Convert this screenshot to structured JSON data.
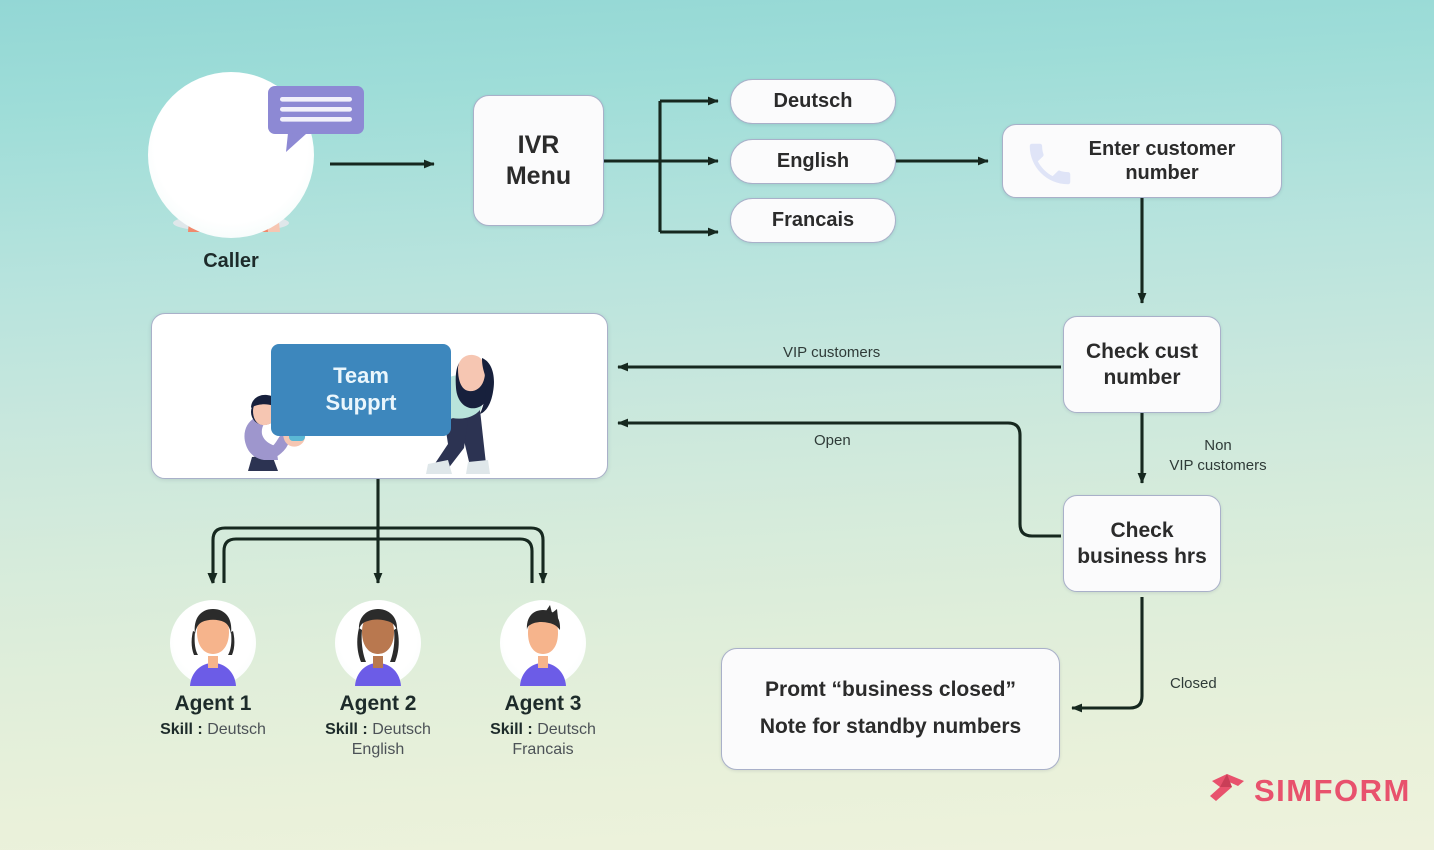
{
  "diagram": {
    "title": "IVR call routing flow",
    "caller": {
      "label": "Caller",
      "icon": "person-on-phone-illustration",
      "bubble": "chat-bubble-icon"
    },
    "ivr": {
      "line1": "IVR",
      "line2": "Menu"
    },
    "languages": [
      {
        "label": "Deutsch"
      },
      {
        "label": "English"
      },
      {
        "label": "Francais"
      }
    ],
    "enter_number": {
      "line1": "Enter customer",
      "line2": "number",
      "icon": "phone-handset-icon"
    },
    "check_cust": {
      "line1": "Check cust",
      "line2": "number"
    },
    "check_hours": {
      "line1": "Check",
      "line2": "business hrs"
    },
    "team": {
      "line1": "Team",
      "line2": "Supprt",
      "banner_color": "#3d87bd"
    },
    "prompt_box": {
      "line1": "Promt “business closed”",
      "line2": "Note for standby numbers"
    },
    "edge_labels": {
      "vip": "VIP customers",
      "open": "Open",
      "non_vip_line1": "Non",
      "non_vip_line2": "VIP customers",
      "closed": "Closed"
    },
    "agents": [
      {
        "name": "Agent 1",
        "skill_label": "Skill :",
        "skills": [
          "Deutsch"
        ]
      },
      {
        "name": "Agent 2",
        "skill_label": "Skill :",
        "skills": [
          "Deutsch",
          "English"
        ]
      },
      {
        "name": "Agent 3",
        "skill_label": "Skill :",
        "skills": [
          "Deutsch",
          "Francais"
        ]
      }
    ],
    "brand": {
      "name": "SIMFORM",
      "mark": "simform-logo-icon",
      "color": "#e8526d"
    },
    "colors": {
      "background_top": "#93d7d5",
      "background_bottom": "#eef2dc",
      "node_fill": "#fbfbfc",
      "node_border": "#a9b0c9",
      "arrow": "#16281f",
      "banner": "#3d87bd",
      "brand": "#e8526d"
    }
  }
}
